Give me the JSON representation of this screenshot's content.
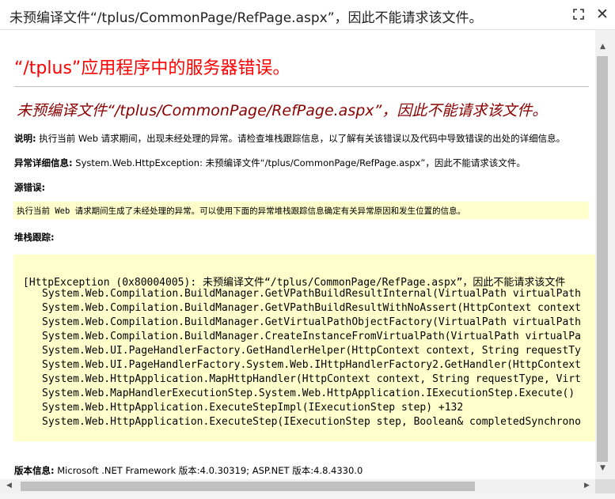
{
  "dialog": {
    "title": "未预编译文件“/tplus/CommonPage/RefPage.aspx”，因此不能请求该文件。",
    "maximize_icon": "maximize-icon",
    "close_icon": "close-icon"
  },
  "error_page": {
    "heading": "“/tplus”应用程序中的服务器错误。",
    "subheading": "未预编译文件“/tplus/CommonPage/RefPage.aspx”，因此不能请求该文件。",
    "description_label": "说明:",
    "description_text": " 执行当前 Web 请求期间，出现未经处理的异常。请检查堆栈跟踪信息，以了解有关该错误以及代码中导致错误的出处的详细信息。",
    "exception_label": "异常详细信息:",
    "exception_text": " System.Web.HttpException: 未预编译文件“/tplus/CommonPage/RefPage.aspx”，因此不能请求该文件。",
    "source_error_label": "源错误:",
    "source_error_text": "执行当前 Web 请求期间生成了未经处理的异常。可以使用下面的异常堆栈跟踪信息确定有关异常原因和发生位置的信息。",
    "stack_trace_label": "堆栈跟踪:",
    "stack_trace_lines": [
      "[HttpException (0x80004005): 未预编译文件“/tplus/CommonPage/RefPage.aspx”，因此不能请求该文件",
      "System.Web.Compilation.BuildManager.GetVPathBuildResultInternal(VirtualPath virtualPath",
      "System.Web.Compilation.BuildManager.GetVPathBuildResultWithNoAssert(HttpContext context",
      "System.Web.Compilation.BuildManager.GetVirtualPathObjectFactory(VirtualPath virtualPath",
      "System.Web.Compilation.BuildManager.CreateInstanceFromVirtualPath(VirtualPath virtualPa",
      "System.Web.UI.PageHandlerFactory.GetHandlerHelper(HttpContext context, String requestTy",
      "System.Web.UI.PageHandlerFactory.System.Web.IHttpHandlerFactory2.GetHandler(HttpContext",
      "System.Web.HttpApplication.MapHttpHandler(HttpContext context, String requestType, Virt",
      "System.Web.MapHandlerExecutionStep.System.Web.HttpApplication.IExecutionStep.Execute()",
      "System.Web.HttpApplication.ExecuteStepImpl(IExecutionStep step) +132",
      "System.Web.HttpApplication.ExecuteStep(IExecutionStep step, Boolean& completedSynchrono"
    ],
    "version_label": "版本信息:",
    "version_text": " Microsoft .NET Framework 版本:4.0.30319; ASP.NET 版本:4.8.4330.0"
  },
  "scrollbars": {
    "up_arrow": "▲",
    "down_arrow": "▼",
    "left_arrow": "◀",
    "right_arrow": "▶"
  }
}
